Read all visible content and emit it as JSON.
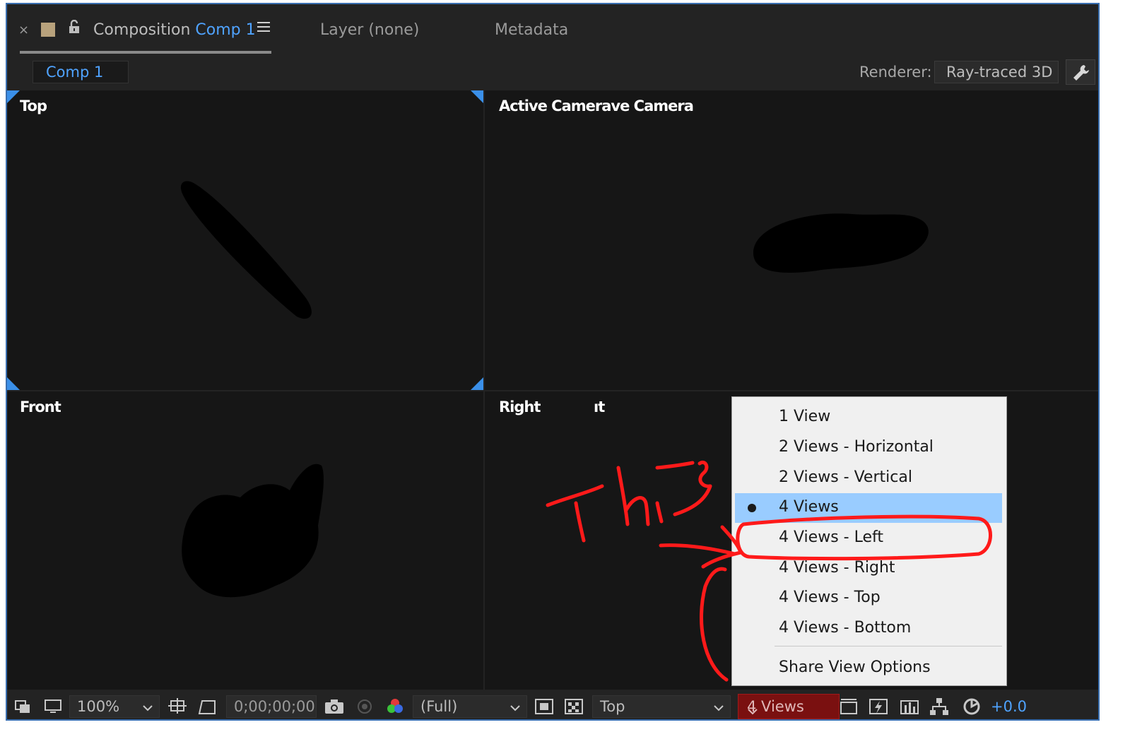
{
  "tabs": {
    "close": "×",
    "composition_prefix": "Composition ",
    "composition_name": "Comp 1",
    "layer": "Layer (none)",
    "metadata": "Metadata"
  },
  "subbar": {
    "comp_chip": "Comp 1",
    "renderer_label": "Renderer:",
    "renderer_value": "Ray-traced 3D"
  },
  "viewers": {
    "top_left": "Top",
    "top_right": "Active Camerave Camera",
    "bottom_left": "Front",
    "bottom_right": "Right",
    "bottom_right_partial": "ıt"
  },
  "toolbar": {
    "zoom": "100%",
    "timecode": "0;00;00;00",
    "resolution": "(Full)",
    "view": "Top",
    "layout": "4 Views",
    "exposure": "+0.0"
  },
  "menu": {
    "items": [
      {
        "label": "1 View",
        "selected": false
      },
      {
        "label": "2 Views - Horizontal",
        "selected": false
      },
      {
        "label": "2 Views - Vertical",
        "selected": false
      },
      {
        "label": "4 Views",
        "selected": true
      },
      {
        "label": "4 Views - Left",
        "selected": false
      },
      {
        "label": "4 Views - Right",
        "selected": false
      },
      {
        "label": "4 Views - Top",
        "selected": false
      },
      {
        "label": "4 Views - Bottom",
        "selected": false
      }
    ],
    "share": "Share View Options"
  },
  "annotation": {
    "text": "This",
    "color": "#ff1a1a"
  },
  "colors": {
    "accent": "#4fa3ff",
    "highlight": "#99ccff",
    "alert": "#7a1010"
  }
}
